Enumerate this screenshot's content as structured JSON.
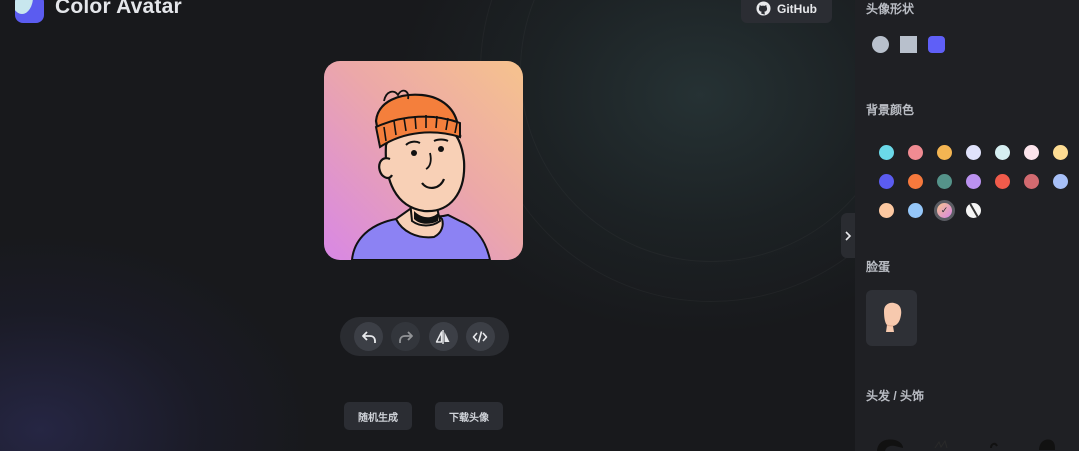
{
  "header": {
    "app_title": "Color Avatar",
    "github_label": "GitHub"
  },
  "preview": {
    "avatar_shape": "squircle",
    "background_gradient": [
      "#f6c38d",
      "#eca8a8",
      "#d887e5"
    ]
  },
  "toolbar": {
    "buttons": [
      {
        "name": "undo",
        "icon": "undo-icon",
        "enabled": true
      },
      {
        "name": "redo",
        "icon": "redo-icon",
        "enabled": false
      },
      {
        "name": "flip",
        "icon": "flip-icon",
        "enabled": true
      },
      {
        "name": "code",
        "icon": "code-icon",
        "enabled": true
      }
    ]
  },
  "actions": {
    "random_label": "随机生成",
    "download_label": "下载头像"
  },
  "sidebar": {
    "shape_title": "头像形状",
    "shapes": [
      "circle",
      "square",
      "squircle"
    ],
    "selected_shape": "squircle",
    "background_title": "背景颜色",
    "colors": [
      "#6bd9e9",
      "#f08b92",
      "#f4b552",
      "#e0e2fb",
      "#d6eff2",
      "#fce4ec",
      "#fddc93",
      "#5b5cf0",
      "#f6793d",
      "#55938a",
      "#bb92f0",
      "#f05b4b",
      "#d26a70",
      "#a7c0f8",
      "#fcc8a1",
      "#95c7f9",
      "gradient",
      "transparent"
    ],
    "selected_color_index": 16,
    "face_title": "脸蛋",
    "hair_title": "头发 / 头饰"
  }
}
